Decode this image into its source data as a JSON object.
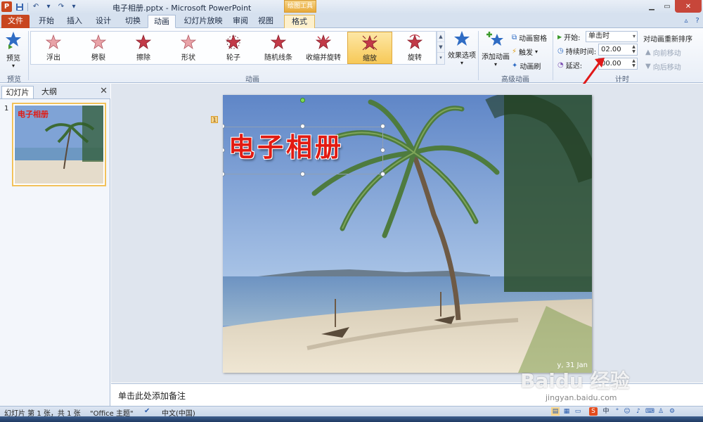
{
  "window": {
    "title": "电子相册.pptx - Microsoft PowerPoint",
    "context_tool": "绘图工具",
    "app_letter": "P"
  },
  "tabs": [
    {
      "label": "文件"
    },
    {
      "label": "开始"
    },
    {
      "label": "插入"
    },
    {
      "label": "设计"
    },
    {
      "label": "切换"
    },
    {
      "label": "动画"
    },
    {
      "label": "幻灯片放映"
    },
    {
      "label": "审阅"
    },
    {
      "label": "视图"
    },
    {
      "label": "格式"
    }
  ],
  "ribbon": {
    "preview": {
      "button": "预览",
      "group": "预览"
    },
    "animation_group": "动画",
    "animations": [
      {
        "label": "浮出",
        "color": "#e8a3a8"
      },
      {
        "label": "劈裂",
        "color": "#e8a3a8"
      },
      {
        "label": "擦除",
        "color": "#c23a48"
      },
      {
        "label": "形状",
        "color": "#e8a3a8"
      },
      {
        "label": "轮子",
        "color": "#c23a48"
      },
      {
        "label": "随机线条",
        "color": "#c23a48"
      },
      {
        "label": "收缩并旋转",
        "color": "#c23a48"
      },
      {
        "label": "缩放",
        "color": "#c23a48"
      },
      {
        "label": "旋转",
        "color": "#c23a48"
      }
    ],
    "effect_options": "效果选项",
    "advanced": {
      "group": "高级动画",
      "add_animation": "添加动画",
      "animation_pane": "动画窗格",
      "trigger": "触发",
      "animation_painter": "动画刷"
    },
    "timing": {
      "group": "计时",
      "start_label": "开始:",
      "start_value": "单击时",
      "duration_label": "持续时间:",
      "duration_value": "02.00",
      "delay_label": "延迟:",
      "delay_value": "00.00",
      "reorder_title": "对动画重新排序",
      "move_earlier": "向前移动",
      "move_later": "向后移动"
    }
  },
  "left_pane": {
    "tab_slides": "幻灯片",
    "tab_outline": "大纲",
    "slide_number": "1",
    "thumb_title": "电子相册"
  },
  "slide": {
    "title": "电子相册",
    "anim_tag": "1",
    "corner_text": "y, 31 Jan"
  },
  "notes": {
    "placeholder": "单击此处添加备注"
  },
  "status": {
    "slide_info": "幻灯片 第 1 张，共 1 张",
    "theme": "\"Office 主题\"",
    "language": "中文(中国)"
  },
  "watermark": {
    "logo": "Baidu 经验",
    "url": "jingyan.baidu.com"
  }
}
